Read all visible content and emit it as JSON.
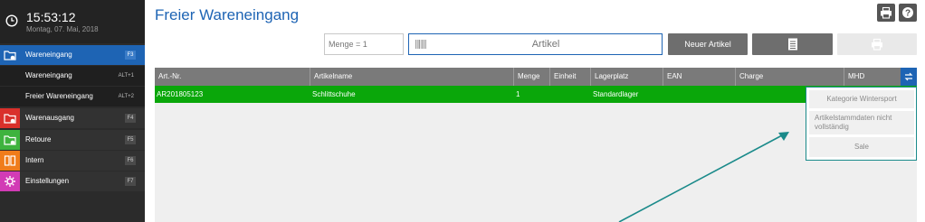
{
  "sidebar": {
    "clock": {
      "time": "15:53:12",
      "date": "Montag, 07. Mai, 2018"
    },
    "items": [
      {
        "label": "Wareneingang",
        "key": "F3",
        "icon": "folder-inbound-icon",
        "color": "#1e64b4"
      },
      {
        "label": "Wareneingang",
        "key": "ALT+1"
      },
      {
        "label": "Freier Wareneingang",
        "key": "ALT+2"
      },
      {
        "label": "Warenausgang",
        "key": "F4",
        "icon": "folder-outbound-icon",
        "color": "#d9302b"
      },
      {
        "label": "Retoure",
        "key": "F5",
        "icon": "folder-return-icon",
        "color": "#3eb33e"
      },
      {
        "label": "Intern",
        "key": "F6",
        "icon": "internal-icon",
        "color": "#f07c1b"
      },
      {
        "label": "Einstellungen",
        "key": "F7",
        "icon": "gear-icon",
        "color": "#d23bb5"
      }
    ]
  },
  "header": {
    "title": "Freier Wareneingang",
    "print_icon": "printer-icon",
    "help_icon": "help-icon"
  },
  "toolbar": {
    "qty_placeholder": "Menge = 1",
    "article_placeholder": "Artikel",
    "new_article_label": "Neuer Artikel"
  },
  "table": {
    "columns": [
      "Art.-Nr.",
      "Artikelname",
      "Menge",
      "Einheit",
      "Lagerplatz",
      "EAN",
      "Charge",
      "MHD"
    ],
    "rows": [
      {
        "art_nr": "AR201805123",
        "name": "Schlittschuhe",
        "menge": "1",
        "einheit": "",
        "lagerplatz": "Standardlager",
        "ean": "",
        "charge": "",
        "mhd": ""
      }
    ]
  },
  "dropdown": {
    "items": [
      "Kategorie Wintersport",
      "Artikelstammdaten nicht vollständig",
      "Sale"
    ]
  },
  "colors": {
    "accent": "#1e64b4",
    "row_selected": "#0aa70a",
    "annotation_arrow": "#1a8a8a"
  }
}
